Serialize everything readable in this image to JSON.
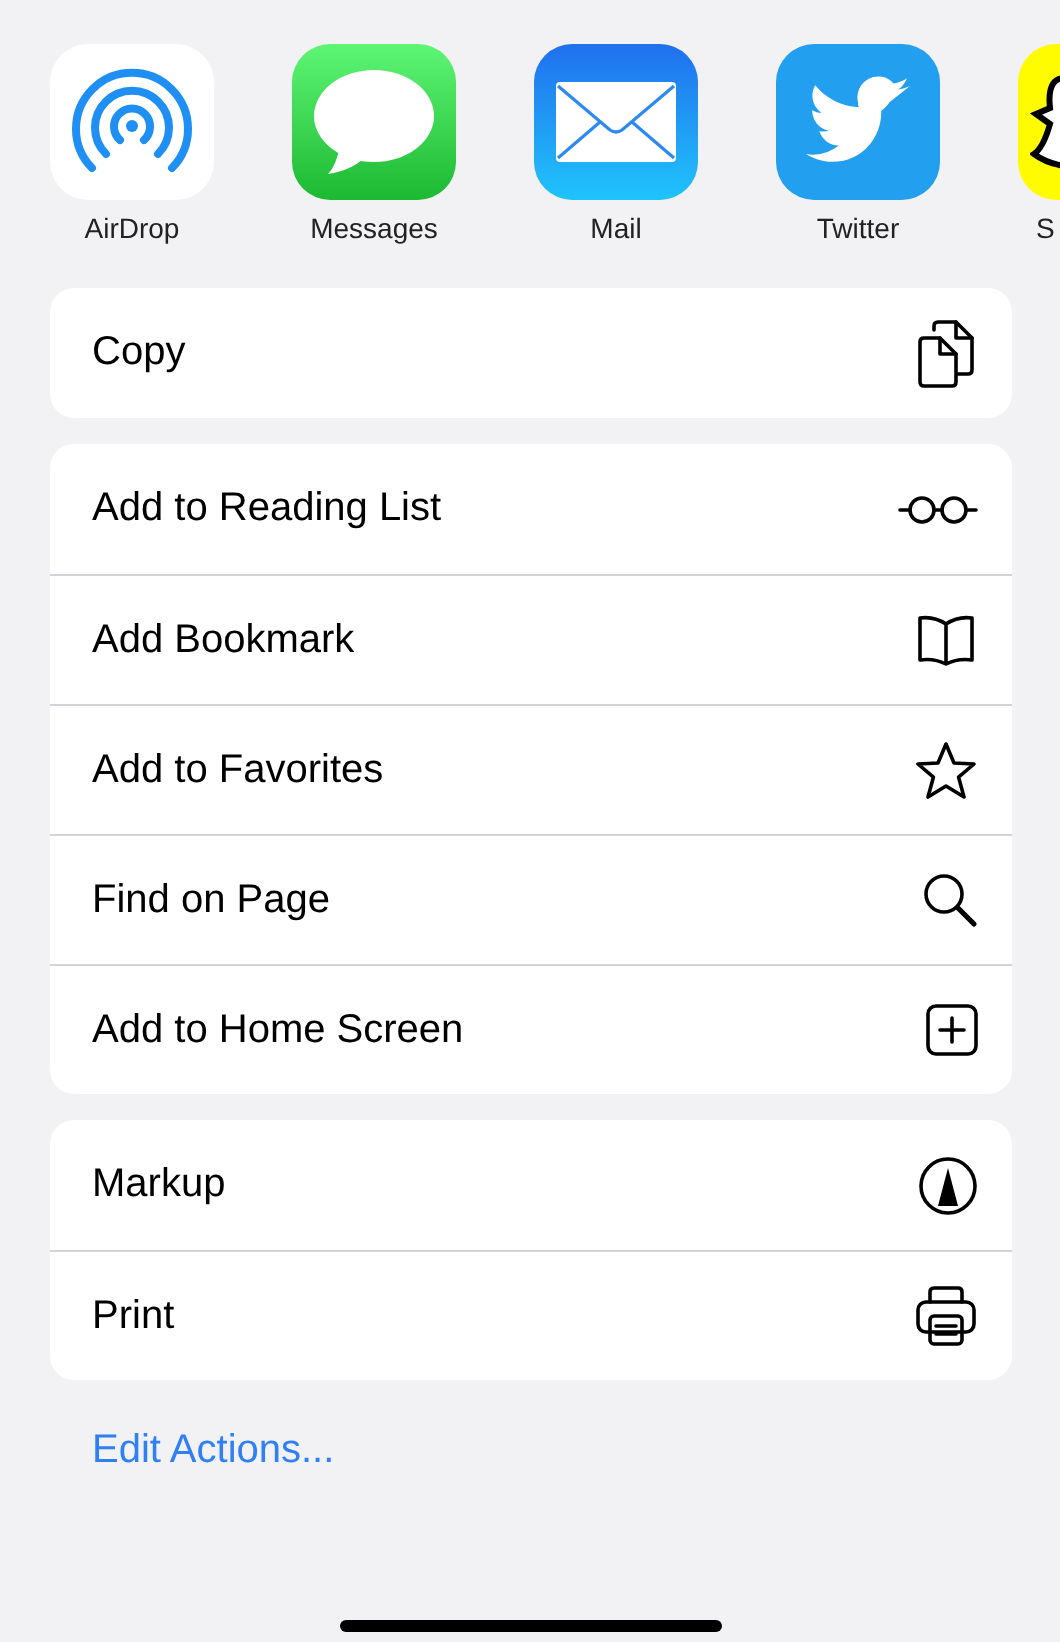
{
  "apps": [
    {
      "kind": "airdrop",
      "label": "AirDrop"
    },
    {
      "kind": "messages",
      "label": "Messages"
    },
    {
      "kind": "mail",
      "label": "Mail"
    },
    {
      "kind": "twitter",
      "label": "Twitter"
    },
    {
      "kind": "snapchat",
      "label": "S"
    }
  ],
  "action_groups": [
    [
      {
        "label": "Copy",
        "kind": "copy"
      }
    ],
    [
      {
        "label": "Add to Reading List",
        "kind": "reading-list"
      },
      {
        "label": "Add Bookmark",
        "kind": "bookmark"
      },
      {
        "label": "Add to Favorites",
        "kind": "favorite"
      },
      {
        "label": "Find on Page",
        "kind": "find"
      },
      {
        "label": "Add to Home Screen",
        "kind": "home-screen"
      }
    ],
    [
      {
        "label": "Markup",
        "kind": "markup"
      },
      {
        "label": "Print",
        "kind": "print"
      }
    ]
  ],
  "edit_actions": "Edit Actions..."
}
